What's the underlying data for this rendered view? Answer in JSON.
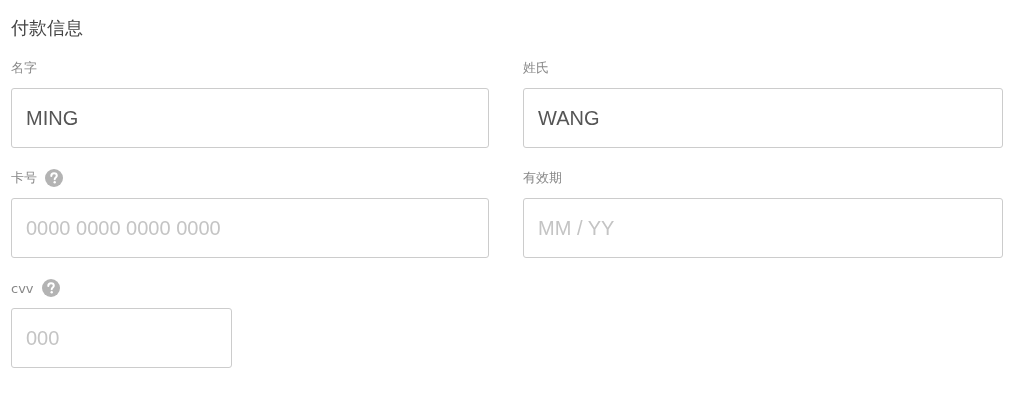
{
  "title": "付款信息",
  "fields": [
    {
      "kind": "wide",
      "label": "名字",
      "value": "MING",
      "help": false
    },
    {
      "kind": "wide",
      "label": "姓氏",
      "value": "WANG",
      "help": false
    },
    {
      "kind": "wide",
      "label": "卡号",
      "placeholder": "0000 0000 0000 0000",
      "help": true
    },
    {
      "kind": "wide",
      "label": "有效期",
      "placeholder": "MM / YY",
      "help": false
    },
    {
      "kind": "narrow",
      "label": "cvv",
      "placeholder": "000",
      "help": true
    }
  ]
}
